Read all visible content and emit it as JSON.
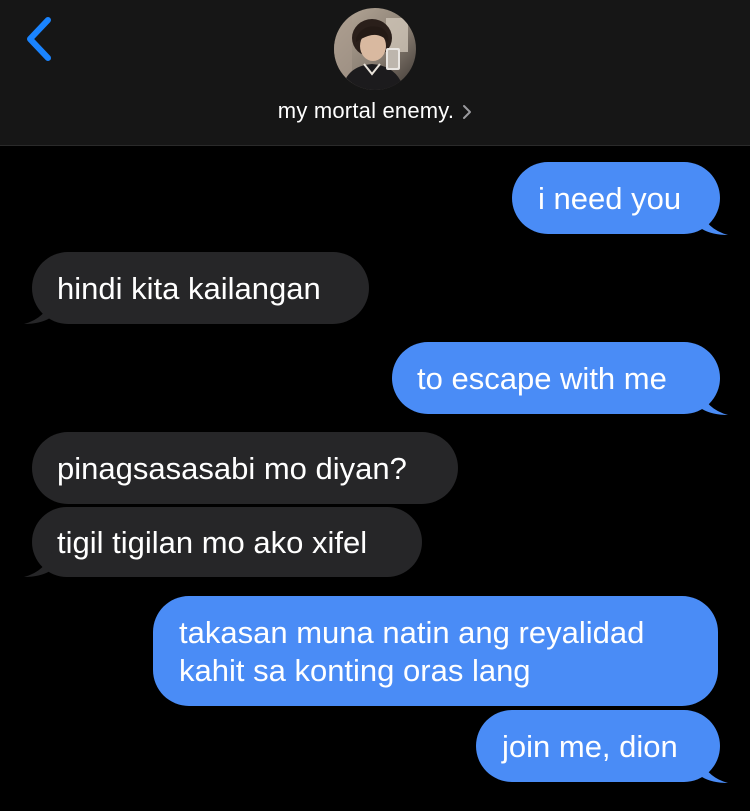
{
  "colors": {
    "background": "#000000",
    "header_bg": "#161616",
    "outgoing_bubble": "#4a8cf6",
    "incoming_bubble": "#262628",
    "accent": "#1a84ff",
    "text": "#ffffff"
  },
  "header": {
    "back_icon": "chevron-left-icon",
    "avatar_alt": "contact-photo",
    "contact_name": "my mortal enemy.",
    "name_chevron_icon": "chevron-right-icon"
  },
  "messages": [
    {
      "direction": "outgoing",
      "text": "i need you"
    },
    {
      "direction": "incoming",
      "text": "hindi kita kailangan"
    },
    {
      "direction": "outgoing",
      "text": "to escape with me"
    },
    {
      "direction": "incoming",
      "text": "pinagsasasabi mo diyan?"
    },
    {
      "direction": "incoming",
      "text": "tigil tigilan mo ako xifel"
    },
    {
      "direction": "outgoing",
      "text_lines": [
        "takasan muna natin ang reyalidad",
        "kahit sa konting oras lang"
      ]
    },
    {
      "direction": "outgoing",
      "text": "join me, dion"
    }
  ]
}
